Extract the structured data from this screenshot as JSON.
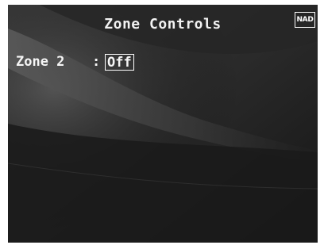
{
  "screen": {
    "title": "Zone Controls",
    "logo_text": "NAD",
    "background_color": "#1b1b1b",
    "text_color": "#f5f5f5"
  },
  "zone_row": {
    "label": "Zone 2",
    "separator": ":",
    "value": "Off"
  }
}
